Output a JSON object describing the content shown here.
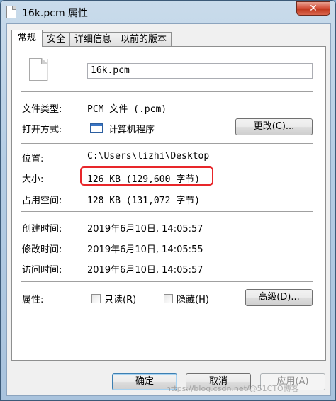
{
  "window": {
    "title": "16k.pcm 属性",
    "close_label": "✕"
  },
  "tabs": [
    {
      "label": "常规",
      "active": true
    },
    {
      "label": "安全",
      "active": false
    },
    {
      "label": "详细信息",
      "active": false
    },
    {
      "label": "以前的版本",
      "active": false
    }
  ],
  "file": {
    "name": "16k.pcm"
  },
  "fields": {
    "type_label": "文件类型:",
    "type_value": "PCM 文件 (.pcm)",
    "open_label": "打开方式:",
    "open_value": "计算机程序",
    "change_button": "更改(C)...",
    "location_label": "位置:",
    "location_value": "C:\\Users\\lizhi\\Desktop",
    "size_label": "大小:",
    "size_value": "126 KB (129,600 字节)",
    "disk_label": "占用空间:",
    "disk_value": "128 KB (131,072 字节)",
    "created_label": "创建时间:",
    "created_value": "2019年6月10日, 14:05:57",
    "modified_label": "修改时间:",
    "modified_value": "2019年6月10日, 14:05:55",
    "accessed_label": "访问时间:",
    "accessed_value": "2019年6月10日, 14:05:57",
    "attrs_label": "属性:",
    "readonly_label": "只读(R)",
    "readonly_checked": false,
    "hidden_label": "隐藏(H)",
    "hidden_checked": false,
    "advanced_button": "高级(D)..."
  },
  "footer": {
    "ok_button": "确定",
    "cancel_button": "取消",
    "apply_button": "应用(A)"
  },
  "watermark": "https://blog.csdn.net/@51CTO博客",
  "colors": {
    "highlight": "#e8262a"
  }
}
